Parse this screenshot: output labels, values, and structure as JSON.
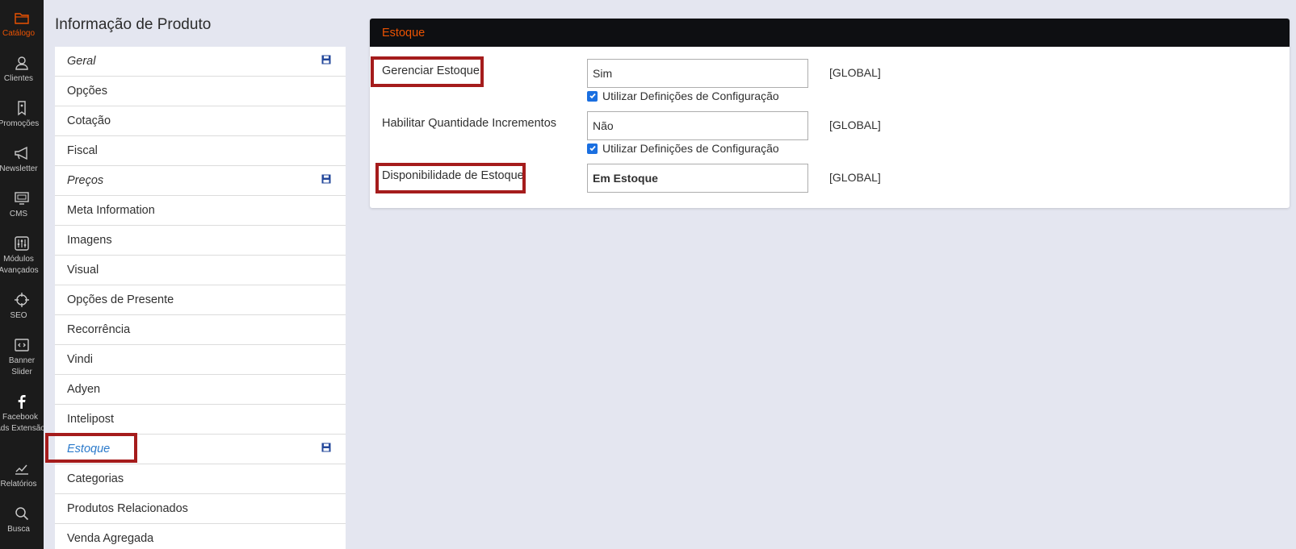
{
  "sidebar": {
    "items": [
      {
        "label": "Catálogo",
        "icon": "folder-icon",
        "active": true
      },
      {
        "label": "Clientes",
        "icon": "user-icon"
      },
      {
        "label": "Promoções",
        "icon": "tag-icon"
      },
      {
        "label": "Newsletter",
        "icon": "megaphone-icon"
      },
      {
        "label": "CMS",
        "icon": "monitor-icon"
      },
      {
        "label": "Módulos Avançados",
        "icon": "sliders-icon"
      },
      {
        "label": "SEO",
        "icon": "crosshair-icon"
      },
      {
        "label": "Banner Slider",
        "icon": "code-icon"
      },
      {
        "label": "Facebook Ads Extensão",
        "icon": "facebook-icon"
      },
      {
        "label": "Relatórios",
        "icon": "chart-icon"
      },
      {
        "label": "Busca",
        "icon": "search-icon"
      }
    ],
    "accent": "#eb5202"
  },
  "page": {
    "title": "Informação de Produto"
  },
  "tabs": [
    {
      "label": "Geral",
      "italic": true,
      "save": true
    },
    {
      "label": "Opções"
    },
    {
      "label": "Cotação"
    },
    {
      "label": "Fiscal"
    },
    {
      "label": "Preços",
      "italic": true,
      "save": true
    },
    {
      "label": "Meta Information"
    },
    {
      "label": "Imagens"
    },
    {
      "label": "Visual"
    },
    {
      "label": "Opções de Presente"
    },
    {
      "label": "Recorrência"
    },
    {
      "label": "Vindi"
    },
    {
      "label": "Adyen"
    },
    {
      "label": "Intelipost"
    },
    {
      "label": "Estoque",
      "italic": true,
      "save": true,
      "active": true
    },
    {
      "label": "Categorias"
    },
    {
      "label": "Produtos Relacionados"
    },
    {
      "label": "Venda Agregada"
    }
  ],
  "section": {
    "title": "Estoque",
    "fields": {
      "manage_stock": {
        "label": "Gerenciar Estoque",
        "value": "Sim",
        "scope": "[GLOBAL]",
        "use_config_label": "Utilizar Definições de Configuração",
        "use_config_checked": true
      },
      "qty_increments": {
        "label": "Habilitar Quantidade Incrementos",
        "value": "Não",
        "scope": "[GLOBAL]",
        "use_config_label": "Utilizar Definições de Configuração",
        "use_config_checked": true
      },
      "stock_availability": {
        "label": "Disponibilidade de Estoque",
        "value": "Em Estoque",
        "scope": "[GLOBAL]"
      }
    }
  },
  "colors": {
    "highlight": "#a51c1c",
    "active_tab": "#2b7acb",
    "header_bg": "#0e0f12",
    "checkbox": "#1a6fe0"
  }
}
